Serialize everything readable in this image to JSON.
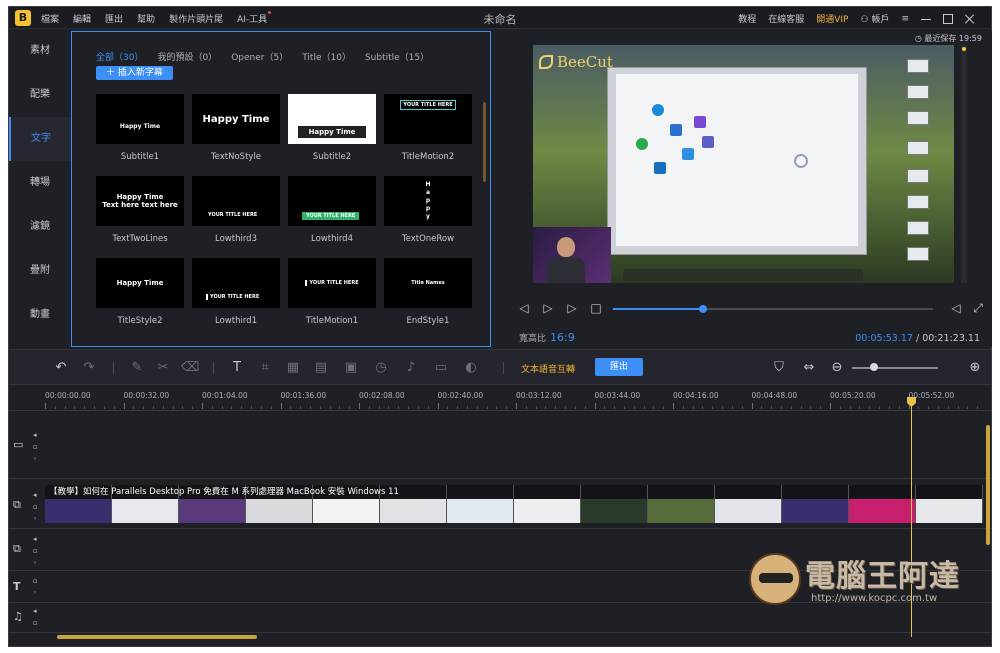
{
  "titlebar": {
    "menus": [
      "檔案",
      "編輯",
      "匯出",
      "幫助",
      "製作片頭片尾",
      "AI-工具"
    ],
    "title": "未命名",
    "right": {
      "tutorial": "教程",
      "support": "在線客服",
      "vip": "開通VIP",
      "account": "帳戶"
    }
  },
  "sidebar": {
    "items": [
      {
        "label": "素材",
        "active": false
      },
      {
        "label": "配樂",
        "active": false
      },
      {
        "label": "文字",
        "active": true
      },
      {
        "label": "轉場",
        "active": false
      },
      {
        "label": "濾鏡",
        "active": false
      },
      {
        "label": "疊附",
        "active": false
      },
      {
        "label": "動畫",
        "active": false
      }
    ]
  },
  "library": {
    "tabs": [
      {
        "label": "全部（30）",
        "active": true
      },
      {
        "label": "我的預設（0）",
        "active": false
      },
      {
        "label": "Opener（5）",
        "active": false
      },
      {
        "label": "Title（10）",
        "active": false
      },
      {
        "label": "Subtitle（15）",
        "active": false
      }
    ],
    "insert_label": "插入新字幕",
    "thumbnails": [
      {
        "label": "Subtitle1",
        "preview": "Happy Time"
      },
      {
        "label": "TextNoStyle",
        "preview": "Happy Time"
      },
      {
        "label": "Subtitle2",
        "preview": "Happy Time"
      },
      {
        "label": "TitleMotion2",
        "preview": "YOUR TITLE HERE"
      },
      {
        "label": "TextTwoLines",
        "preview": "Happy Time\nText here text here"
      },
      {
        "label": "Lowthird3",
        "preview": "YOUR TITLE HERE"
      },
      {
        "label": "Lowthird4",
        "preview": "YOUR TITLE HERE"
      },
      {
        "label": "TextOneRow",
        "preview": "Happy"
      },
      {
        "label": "TitleStyle2",
        "preview": "Happy Time"
      },
      {
        "label": "Lowthird1",
        "preview": "YOUR TITLE HERE"
      },
      {
        "label": "TitleMotion1",
        "preview": "YOUR TITLE HERE"
      },
      {
        "label": "EndStyle1",
        "preview": "Title Names"
      }
    ]
  },
  "preview": {
    "autosave": "最近保存 19:59",
    "brand": "BeeCut",
    "aspect_label": "寬高比",
    "aspect_value": "16:9",
    "current_time": "00:05:53.17",
    "total_time": "/ 00:21:23.11",
    "progress": 0.28
  },
  "toolbar": {
    "tts_label": "文本語音互轉",
    "export_label": "匯出",
    "zoom": 0.25
  },
  "ruler": {
    "labels": [
      "00:00:00.00",
      "00:00:32.00",
      "00:01:04.00",
      "00:01:36.00",
      "00:02:08.00",
      "00:02:40.00",
      "00:03:12.00",
      "00:03:44.00",
      "00:04:16.00",
      "00:04:48.00",
      "00:05:20.00",
      "00:05:52.00"
    ]
  },
  "timeline": {
    "clip_title": "【教學】如何在 Parallels Desktop Pro 免費在 M 系列處理器 MacBook 安裝 Windows 11",
    "clip_colors": [
      "#3a2e6e",
      "#e8e9ee",
      "#5a3a7a",
      "#d8dade",
      "#f2f3f5",
      "#e0e2e6",
      "#dfe7ef",
      "#eceef1",
      "#2a3a2a",
      "#556b3a",
      "#e3e5ea",
      "#3a2e6e",
      "#c81e6e",
      "#e6e8ec"
    ]
  },
  "watermark": {
    "title": "電腦王阿達",
    "url": "http://www.kocpc.com.tw"
  }
}
